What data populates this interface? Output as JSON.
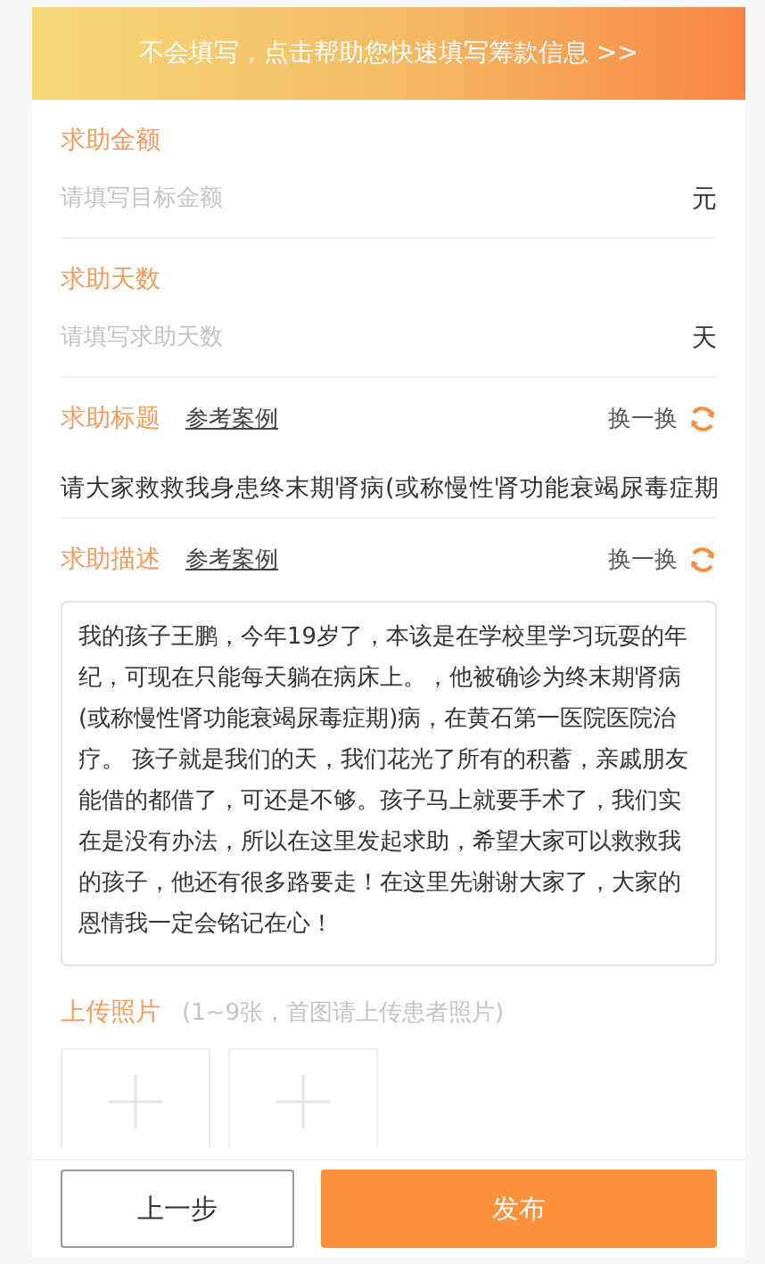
{
  "banner": {
    "text": "不会填写，点击帮助您快速填写筹款信息 >>"
  },
  "fields": [
    {
      "kind": "input",
      "label": "求助金额",
      "placeholder": "请填写目标金额",
      "unit": "元"
    },
    {
      "kind": "input",
      "label": "求助天数",
      "placeholder": "请填写求助天数",
      "unit": "天"
    },
    {
      "kind": "line",
      "label": "求助标题",
      "example_link": "参考案例",
      "refresh": "换一换",
      "value": "请大家救救我身患终末期肾病(或称慢性肾功能衰竭尿毒症期"
    },
    {
      "kind": "area",
      "label": "求助描述",
      "example_link": "参考案例",
      "refresh": "换一换",
      "value": "我的孩子王鹏，今年19岁了，本该是在学校里学习玩耍的年纪，可现在只能每天躺在病床上。，他被确诊为终末期肾病(或称慢性肾功能衰竭尿毒症期)病，在黄石第一医院医院治疗。 孩子就是我们的天，我们花光了所有的积蓄，亲戚朋友能借的都借了，可还是不够。孩子马上就要手术了，我们实在是没有办法，所以在这里发起求助，希望大家可以救救我的孩子，他还有很多路要走！在这里先谢谢大家了，大家的恩情我一定会铭记在心！"
    }
  ],
  "upload": {
    "label": "上传照片",
    "hint": "(1~9张，首图请上传患者照片)",
    "slots": [
      {
        "kind": "add"
      },
      {
        "kind": "add"
      }
    ]
  },
  "buttons": [
    {
      "kind": "secondary",
      "label": "上一步"
    },
    {
      "kind": "primary",
      "label": "发布"
    }
  ]
}
